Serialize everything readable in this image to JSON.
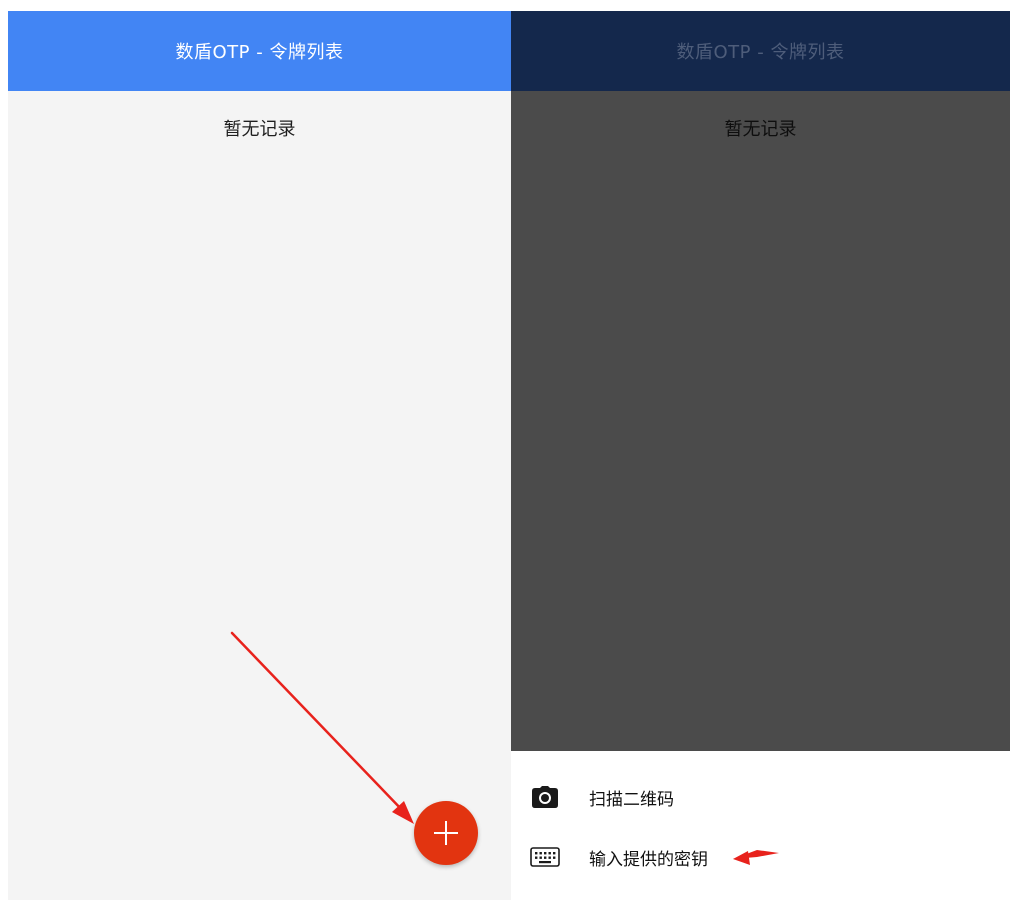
{
  "left_screen": {
    "app_title": "数盾OTP - 令牌列表",
    "empty_message": "暂无记录",
    "fab": {
      "icon": "plus-icon",
      "color": "#e23410"
    },
    "appbar_color": "#4285f4"
  },
  "right_screen": {
    "app_title": "数盾OTP - 令牌列表",
    "empty_message": "暂无记录",
    "overlay_color": "#4b4b4b",
    "bottom_sheet": {
      "items": [
        {
          "icon": "camera-icon",
          "label": "扫描二维码"
        },
        {
          "icon": "keyboard-icon",
          "label": "输入提供的密钥"
        }
      ]
    }
  },
  "annotations": {
    "arrow_color": "#e8221c"
  }
}
